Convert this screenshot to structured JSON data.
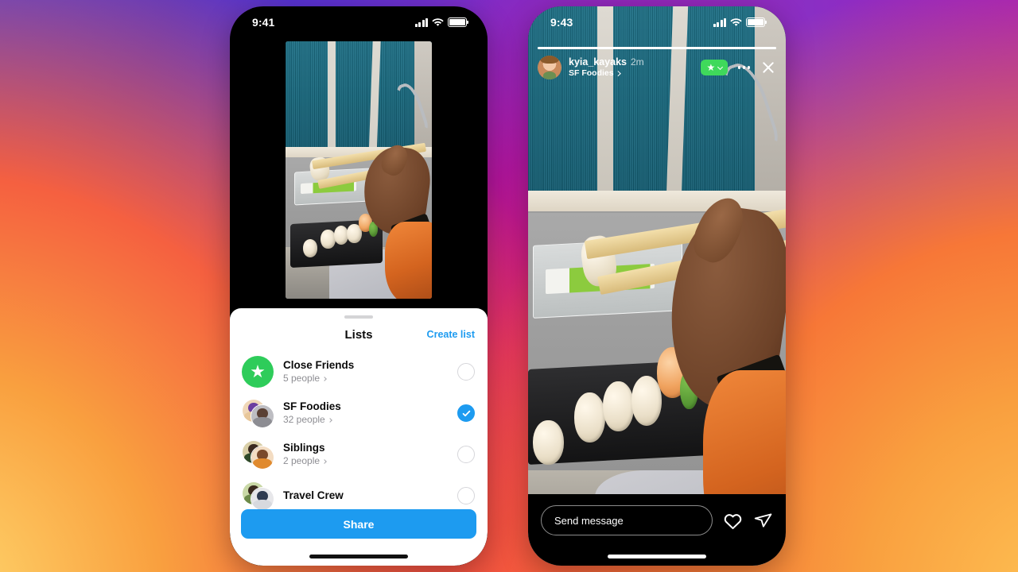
{
  "background": {
    "description": "Instagram brand gradient backdrop",
    "colors": {
      "top_left": "#3f3ce0",
      "top_right": "#8a2fc4",
      "mid_left": "#f0572f",
      "mid_right": "#e0176d",
      "bottom_left": "#f8b84a",
      "bottom_right": "#ee2a48"
    }
  },
  "left_phone": {
    "status_bar": {
      "time": "9:41",
      "cellular_icon": "signal-bars-icon",
      "wifi_icon": "wifi-icon",
      "battery_icon": "battery-icon"
    },
    "photo": {
      "alt": "person eating sushi rolls with chopsticks on a train",
      "icon": "sushi-photo"
    },
    "sheet": {
      "grabber": "drag-handle",
      "title": "Lists",
      "create_list_label": "Create list",
      "items": [
        {
          "name": "Close Friends",
          "count_label": "5 people",
          "avatar_type": "close-friends-star",
          "selected": false
        },
        {
          "name": "SF Foodies",
          "count_label": "32 people",
          "avatar_type": "avatar-stack",
          "selected": true
        },
        {
          "name": "Siblings",
          "count_label": "2 people",
          "avatar_type": "avatar-stack",
          "selected": false
        },
        {
          "name": "Travel Crew",
          "count_label": "",
          "avatar_type": "avatar-stack",
          "selected": false
        }
      ],
      "share_label": "Share",
      "accent_color": "#1d9bf0",
      "close_friends_green": "#2ecc5a"
    }
  },
  "right_phone": {
    "status_bar": {
      "time": "9:43",
      "cellular_icon": "signal-bars-icon",
      "wifi_icon": "wifi-icon",
      "battery_icon": "battery-icon"
    },
    "story": {
      "progress_percent": 100,
      "username": "kyia_kayaks",
      "timestamp": "2m",
      "list_label": "SF Foodies",
      "list_chevron_icon": "chevron-right-icon",
      "badge": {
        "star_icon": "star-icon",
        "chevron_icon": "chevron-down-icon",
        "color": "#3fd95b"
      },
      "more_icon": "more-options-icon",
      "close_icon": "close-icon",
      "photo_alt": "person eating sushi rolls with chopsticks on a train"
    },
    "footer": {
      "message_placeholder": "Send message",
      "like_icon": "heart-icon",
      "share_icon": "send-icon"
    }
  }
}
